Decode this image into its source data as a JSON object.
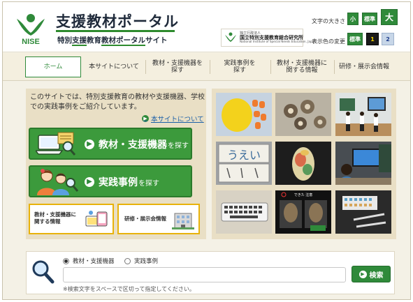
{
  "header": {
    "title": "支援教材ポータル",
    "subtitle_parts": [
      "特別",
      "支援",
      "教育",
      "教材",
      "ポータル",
      "サイト"
    ],
    "logo_text": "NISE",
    "institute": {
      "line1": "独立行政法人",
      "line2": "国立特別支援教育総合研究所",
      "line3": "National Institute of Special Needs Education, Japan"
    },
    "font_size_label": "文字の大きさ",
    "font_small": "小",
    "font_normal": "標準",
    "font_large": "大",
    "color_label": "表示色の変更",
    "color_standard": "標準",
    "color_1": "1",
    "color_2": "2"
  },
  "nav": {
    "items": [
      {
        "label": "ホーム"
      },
      {
        "label": "本サイトについて"
      },
      {
        "label": "教材・支援機器を\n探す"
      },
      {
        "label": "実践事例を\n探す"
      },
      {
        "label": "教材・支援機器に\n関する情報"
      },
      {
        "label": "研修・展示会情報"
      }
    ]
  },
  "intro": {
    "text": "このサイトでは、特別支援教育の教材や支援機器、学校での実践事例をご紹介しています。",
    "about_link": "本サイトについて"
  },
  "buttons": {
    "materials": {
      "main": "教材・支援機器",
      "suffix": "を探す"
    },
    "cases": {
      "main": "実践事例",
      "suffix": "を探す"
    },
    "info": "教材・支援機器に関する情報",
    "research": "研修・展示会情報"
  },
  "photos": {
    "hiragana_card": "うえい",
    "screen_caption": "できた 注意"
  },
  "search": {
    "radio_materials": "教材・支援機器",
    "radio_cases": "実践事例",
    "selected": "教材・支援機器",
    "input_value": "",
    "button": "検索",
    "hint": "※検索文字をスペースで区切って指定してください。"
  },
  "colors": {
    "accent_green": "#2f8a3a",
    "panel_beige": "#e9dfc5",
    "link_blue": "#1a5fa8",
    "info_border": "#e8b20a"
  }
}
